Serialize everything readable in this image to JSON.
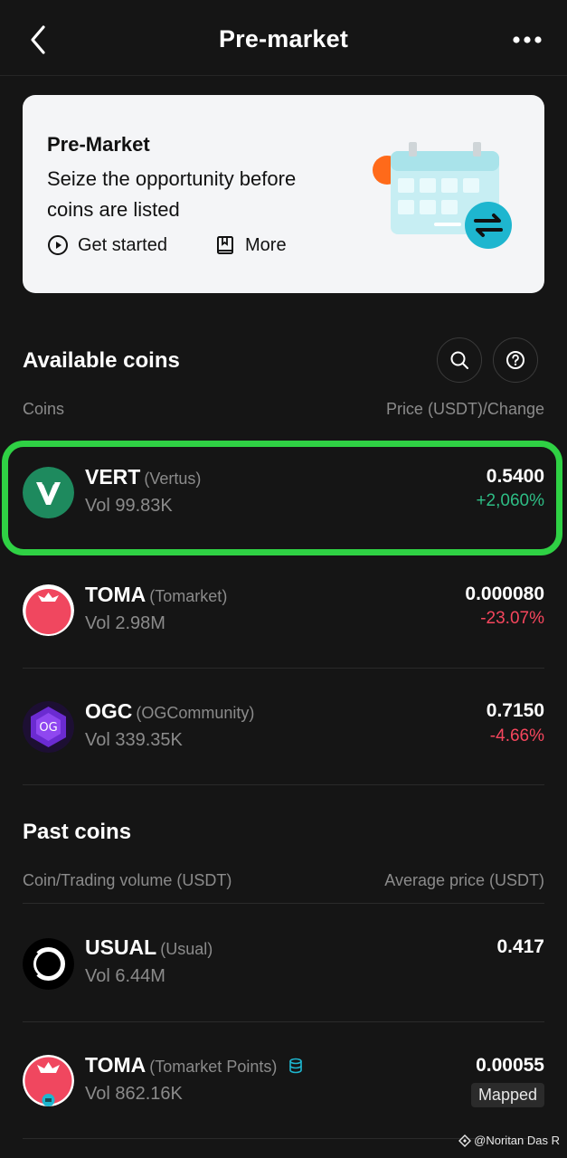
{
  "header": {
    "title": "Pre-market",
    "back_icon": "chevron-left-icon",
    "more_icon": "more-dots-icon"
  },
  "banner": {
    "title": "Pre-Market",
    "description": "Seize the opportunity before coins are listed",
    "get_started_label": "Get started",
    "more_label": "More"
  },
  "available": {
    "title": "Available coins",
    "col_left": "Coins",
    "col_right": "Price (USDT)/Change",
    "coins": [
      {
        "symbol": "VERT",
        "name": "(Vertus)",
        "volume": "Vol 99.83K",
        "price": "0.5400",
        "change": "+2,060%",
        "change_dir": "up"
      },
      {
        "symbol": "TOMA",
        "name": "(Tomarket)",
        "volume": "Vol 2.98M",
        "price": "0.000080",
        "change": "-23.07%",
        "change_dir": "down"
      },
      {
        "symbol": "OGC",
        "name": "(OGCommunity)",
        "volume": "Vol 339.35K",
        "price": "0.7150",
        "change": "-4.66%",
        "change_dir": "down"
      }
    ]
  },
  "past": {
    "title": "Past coins",
    "col_left": "Coin/Trading volume (USDT)",
    "col_right": "Average price (USDT)",
    "coins": [
      {
        "symbol": "USUAL",
        "name": "(Usual)",
        "volume": "Vol 6.44M",
        "avg_price": "0.417"
      },
      {
        "symbol": "TOMA",
        "name": "(Tomarket Points)",
        "volume": "Vol 862.16K",
        "avg_price": "0.00055",
        "badge": "Mapped"
      }
    ]
  },
  "watermark": "@Noritan Das R",
  "colors": {
    "up": "#2ebd85",
    "down": "#f6465d",
    "highlight": "#2fd144",
    "background": "#151515"
  }
}
